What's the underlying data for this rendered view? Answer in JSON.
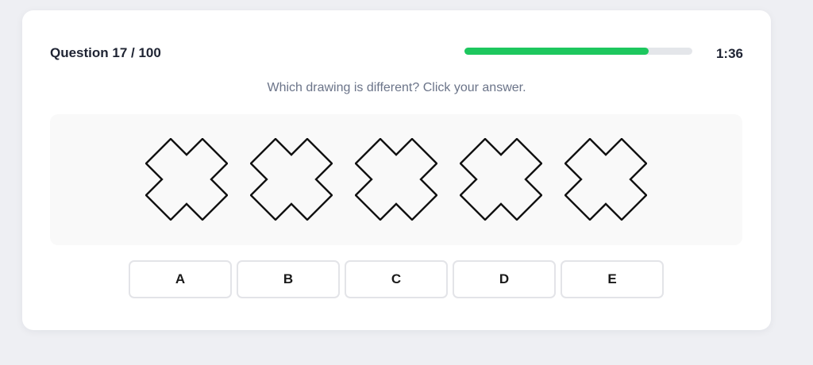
{
  "quiz": {
    "question_counter": "Question 17 / 100",
    "progress": 0.81,
    "timer": "1:36",
    "instruction": "Which drawing is different? Click your answer."
  },
  "figures": [
    {
      "shape": "four-notch-cross"
    },
    {
      "shape": "four-notch-cross"
    },
    {
      "shape": "four-notch-cross"
    },
    {
      "shape": "four-notch-cross"
    },
    {
      "shape": "four-notch-cross"
    }
  ],
  "answers": [
    "A",
    "B",
    "C",
    "D",
    "E"
  ],
  "colors": {
    "progress_fill": "#1dc75e",
    "progress_track": "#e4e6ea",
    "figure_stroke": "#111111"
  }
}
